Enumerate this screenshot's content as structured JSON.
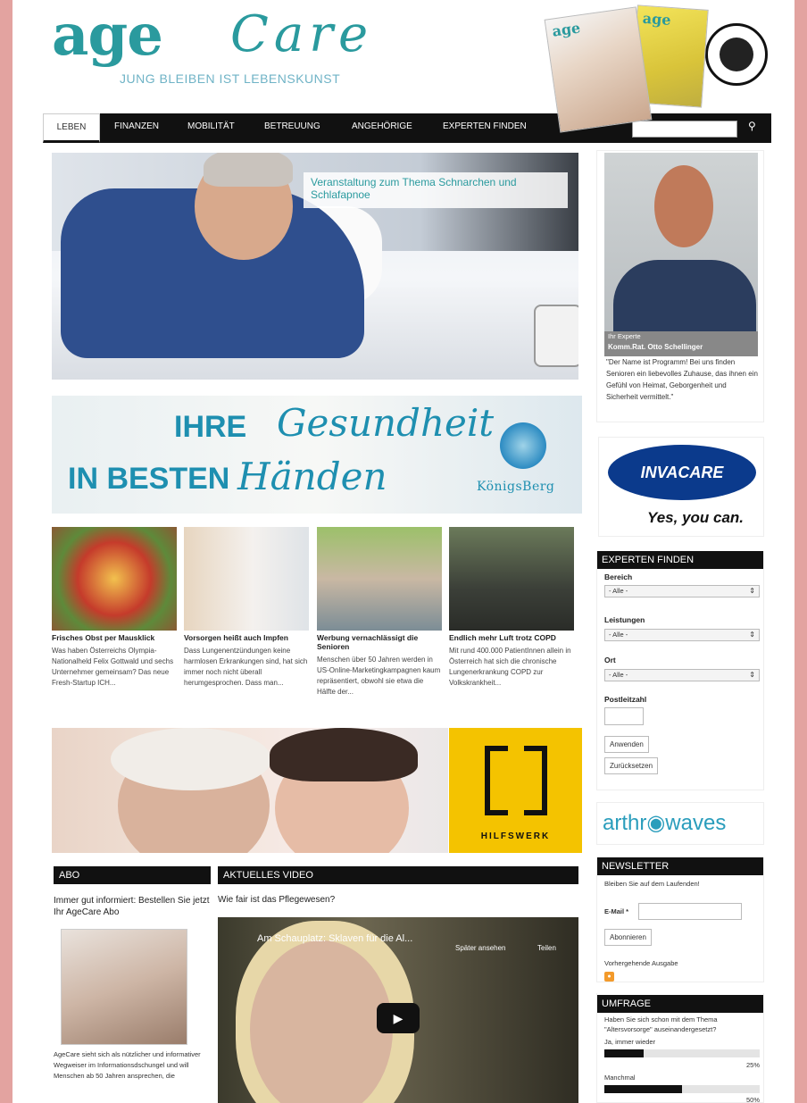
{
  "header": {
    "logo_age": "age",
    "logo_care": "Care",
    "tagline": "JUNG BLEIBEN IST LEBENSKUNST",
    "magazine_title": "age",
    "magazine_title2": "age"
  },
  "nav": {
    "items": [
      {
        "label": "LEBEN",
        "active": true
      },
      {
        "label": "FINANZEN",
        "active": false
      },
      {
        "label": "MOBILITÄT",
        "active": false
      },
      {
        "label": "BETREUUNG",
        "active": false
      },
      {
        "label": "ANGEHÖRIGE",
        "active": false
      },
      {
        "label": "EXPERTEN FINDEN",
        "active": false
      }
    ],
    "search_icon": "search-icon"
  },
  "hero": {
    "caption": "Veranstaltung zum Thema Schnarchen und Schlafapnoe"
  },
  "banner": {
    "line1_bold": "IHRE",
    "line1_script": "Gesundheit",
    "line2_bold": "IN BESTEN",
    "line2_script": "Händen",
    "brand": "KönigsBerg"
  },
  "articles": [
    {
      "title": "Frisches Obst per Mausklick",
      "text": "Was haben Österreichs Olympia-Nationalheld Felix Gottwald und sechs Unternehmer gemeinsam? Das neue Fresh-Startup ICH...",
      "color": "#9c6a3f"
    },
    {
      "title": "Vorsorgen heißt auch Impfen",
      "text": "Dass Lungenentzündungen keine harmlosen Erkrankungen sind, hat sich immer noch nicht überall herumgesprochen. Dass man...",
      "color": "#e7e1da"
    },
    {
      "title": "Werbung vernachlässigt die Senioren",
      "text": "Menschen über 50 Jahren werden in US-Online-Marketingkampagnen kaum repräsentiert, obwohl sie etwa die Hälfte der...",
      "color": "#8fae63"
    },
    {
      "title": "Endlich mehr Luft trotz COPD",
      "text": "Mit rund 400.000 PatientInnen allein in Österreich hat sich die chronische Lungenerkrankung COPD zur Volkskrankheit...",
      "color": "#4a5a44"
    }
  ],
  "hilfswerk": {
    "label": "HILFSWERK"
  },
  "abo": {
    "heading": "ABO",
    "text": "Immer gut informiert: Bestellen Sie jetzt Ihr AgeCare Abo",
    "description": "AgeCare sieht sich als nützlicher und informativer Wegweiser im Informationsdschungel und will Menschen ab 50 Jahren ansprechen, die"
  },
  "video": {
    "heading": "AKTUELLES VIDEO",
    "question": "Wie fair ist das Pflegewesen?",
    "title": "Am Schauplatz: Sklaven für die Al...",
    "watch_later": "Später ansehen",
    "share": "Teilen",
    "play_icon": "▶"
  },
  "expert": {
    "role": "Ihr Experte",
    "name": "Komm.Rat. Otto Schellinger",
    "quote": "\"Der Name ist Programm! Bei uns finden Senioren ein liebevolles Zuhause, das ihnen ein Gefühl von Heimat, Geborgenheit und Sicherheit vermittelt.\""
  },
  "invacare": {
    "brand": "INVACARE",
    "slogan": "Yes, you can."
  },
  "expert_find": {
    "heading": "EXPERTEN FINDEN",
    "bereich_label": "Bereich",
    "bereich_value": "- Alle -",
    "leistungen_label": "Leistungen",
    "leistungen_value": "- Alle -",
    "ort_label": "Ort",
    "ort_value": "- Alle -",
    "plz_label": "Postleitzahl",
    "apply_label": "Anwenden",
    "reset_label": "Zurücksetzen"
  },
  "arthrowaves": {
    "brand": "arthr◉waves"
  },
  "newsletter": {
    "heading": "NEWSLETTER",
    "intro": "Bleiben Sie auf dem Laufenden!",
    "email_label": "E-Mail *",
    "subscribe_label": "Abonnieren",
    "previous_label": "Vorhergehende Ausgabe"
  },
  "poll": {
    "heading": "UMFRAGE",
    "question": "Haben Sie sich schon mit dem Thema \"Altersvorsorge\" auseinandergesetzt?",
    "options": [
      {
        "label": "Ja, immer wieder",
        "percent": 25,
        "percent_label": "25%"
      },
      {
        "label": "Manchmal",
        "percent": 50,
        "percent_label": "50%"
      }
    ]
  }
}
